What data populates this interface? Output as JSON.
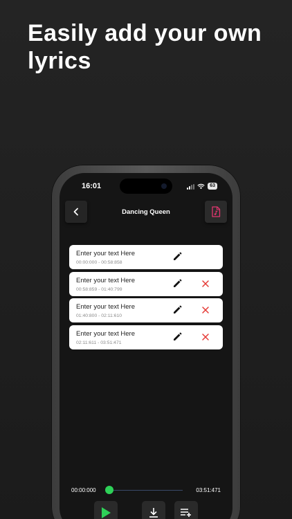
{
  "headline": "Easily add your own lyrics",
  "status": {
    "time": "16:01",
    "battery": "63"
  },
  "header": {
    "title": "Dancing Queen"
  },
  "lyrics": [
    {
      "text": "Enter your text Here",
      "time": "00:00:000 - 00:58:858",
      "deletable": false
    },
    {
      "text": "Enter your text Here",
      "time": "00:58:859 - 01:40:799",
      "deletable": true
    },
    {
      "text": "Enter your text Here",
      "time": "01:40:800 - 02:11:610",
      "deletable": true
    },
    {
      "text": "Enter your text Here",
      "time": "02:11:611 - 03:51:471",
      "deletable": true
    }
  ],
  "player": {
    "current_time": "00:00:000",
    "total_time": "03:51:471",
    "progress": 0
  },
  "colors": {
    "accent_pink": "#e2366f",
    "play_green": "#2ed158",
    "delete_red": "#e53935"
  },
  "icons": {
    "back": "chevron-left-icon",
    "file": "music-file-icon",
    "edit": "pencil-icon",
    "delete": "close-icon",
    "play": "play-icon",
    "download": "download-icon",
    "add": "playlist-add-icon"
  }
}
